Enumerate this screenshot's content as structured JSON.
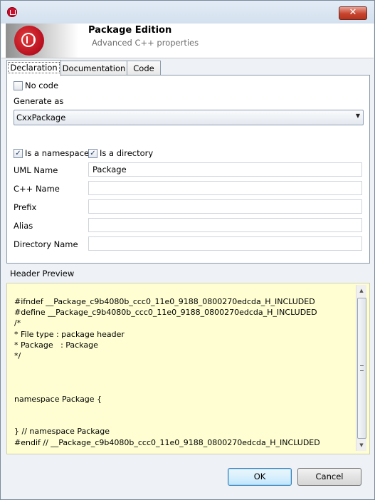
{
  "window": {
    "close_glyph": "✕"
  },
  "header": {
    "title": "Package Edition",
    "subtitle": "Advanced C++ properties"
  },
  "tabs": [
    {
      "label": "Declaration",
      "active": true
    },
    {
      "label": "Documentation",
      "active": false
    },
    {
      "label": "Code",
      "active": false
    }
  ],
  "declaration": {
    "no_code": {
      "label": "No code",
      "checked": false
    },
    "generate_as": {
      "label": "Generate as",
      "value": "CxxPackage"
    },
    "is_namespace": {
      "label": "Is a namespace",
      "checked": true
    },
    "is_directory": {
      "label": "Is a directory",
      "checked": true
    },
    "uml_name": {
      "label": "UML Name",
      "value": "Package"
    },
    "cpp_name": {
      "label": "C++ Name",
      "value": ""
    },
    "prefix": {
      "label": "Prefix",
      "value": ""
    },
    "alias": {
      "label": "Alias",
      "value": ""
    },
    "directory_name": {
      "label": "Directory Name",
      "value": ""
    }
  },
  "preview": {
    "label": "Header Preview",
    "code": "#ifndef __Package_c9b4080b_ccc0_11e0_9188_0800270edcda_H_INCLUDED\n#define __Package_c9b4080b_ccc0_11e0_9188_0800270edcda_H_INCLUDED\n/*\n* File type : package header\n* Package   : Package\n*/\n\n\n\nnamespace Package {\n\n\n} // namespace Package\n#endif // __Package_c9b4080b_ccc0_11e0_9188_0800270edcda_H_INCLUDED"
  },
  "buttons": {
    "ok": "OK",
    "cancel": "Cancel"
  },
  "colors": {
    "preview_bg": "#fefed2",
    "accent_red": "#c8102e"
  },
  "icons": {
    "check": "✓",
    "dropdown": "▼",
    "scroll_up": "▲",
    "scroll_down": "▼"
  }
}
